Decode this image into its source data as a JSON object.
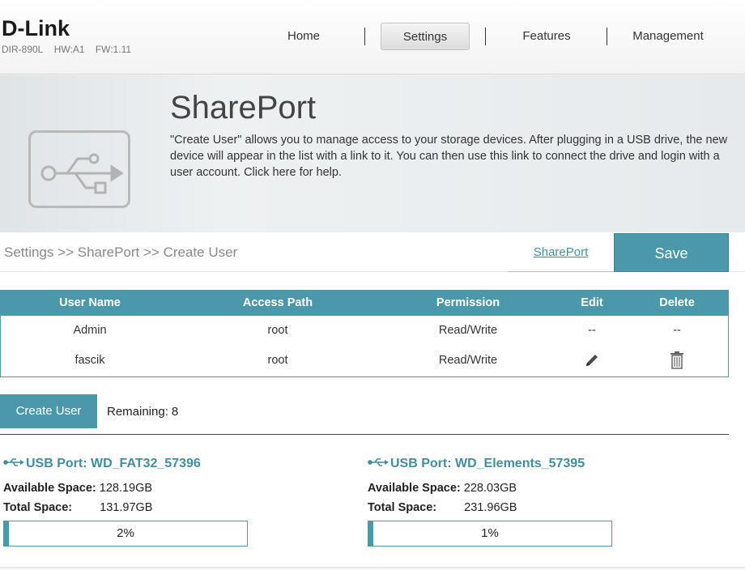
{
  "header": {
    "brand": "D-Link",
    "model": "DIR-890L",
    "hw": "HW:A1",
    "fw": "FW:1.11",
    "nav": [
      {
        "label": "Home"
      },
      {
        "label": "Settings",
        "active": true
      },
      {
        "label": "Features"
      },
      {
        "label": "Management"
      }
    ]
  },
  "banner": {
    "icon": "usb-drive-icon",
    "title": "SharePort",
    "description": "\"Create User\" allows you to manage access to your storage devices. After plugging in a USB drive, the new device will appear in the list with a link to it. You can then use this link to connect the drive and login with a user account. Click here for help."
  },
  "breadcrumb": "Settings >> SharePort >> Create User",
  "actions": {
    "shareport_link": "SharePort",
    "save_label": "Save"
  },
  "users_table": {
    "headers": {
      "user_name": "User Name",
      "access_path": "Access Path",
      "permission": "Permission",
      "edit": "Edit",
      "delete": "Delete"
    },
    "rows": [
      {
        "user_name": "Admin",
        "access_path": "root",
        "permission": "Read/Write",
        "edit": "--",
        "delete": "--"
      },
      {
        "user_name": "fascik",
        "access_path": "root",
        "permission": "Read/Write",
        "edit_icon": "pencil-icon",
        "delete_icon": "trash-icon"
      }
    ]
  },
  "create_user": {
    "label": "Create User",
    "remaining_label": "Remaining:",
    "remaining_value": "8"
  },
  "usb_ports": [
    {
      "title": "USB Port: WD_FAT32_57396",
      "available_label": "Available Space:",
      "available_value": "128.19GB",
      "total_label": "Total Space:",
      "total_value": "131.97GB",
      "usage_percent": 2,
      "usage_text": "2%"
    },
    {
      "title": "USB Port: WD_Elements_57395",
      "available_label": "Available Space:",
      "available_value": "228.03GB",
      "total_label": "Total Space:",
      "total_value": "231.96GB",
      "usage_percent": 1,
      "usage_text": "1%"
    }
  ],
  "colors": {
    "accent": "#4a98aa",
    "link": "#3e8e9f"
  }
}
